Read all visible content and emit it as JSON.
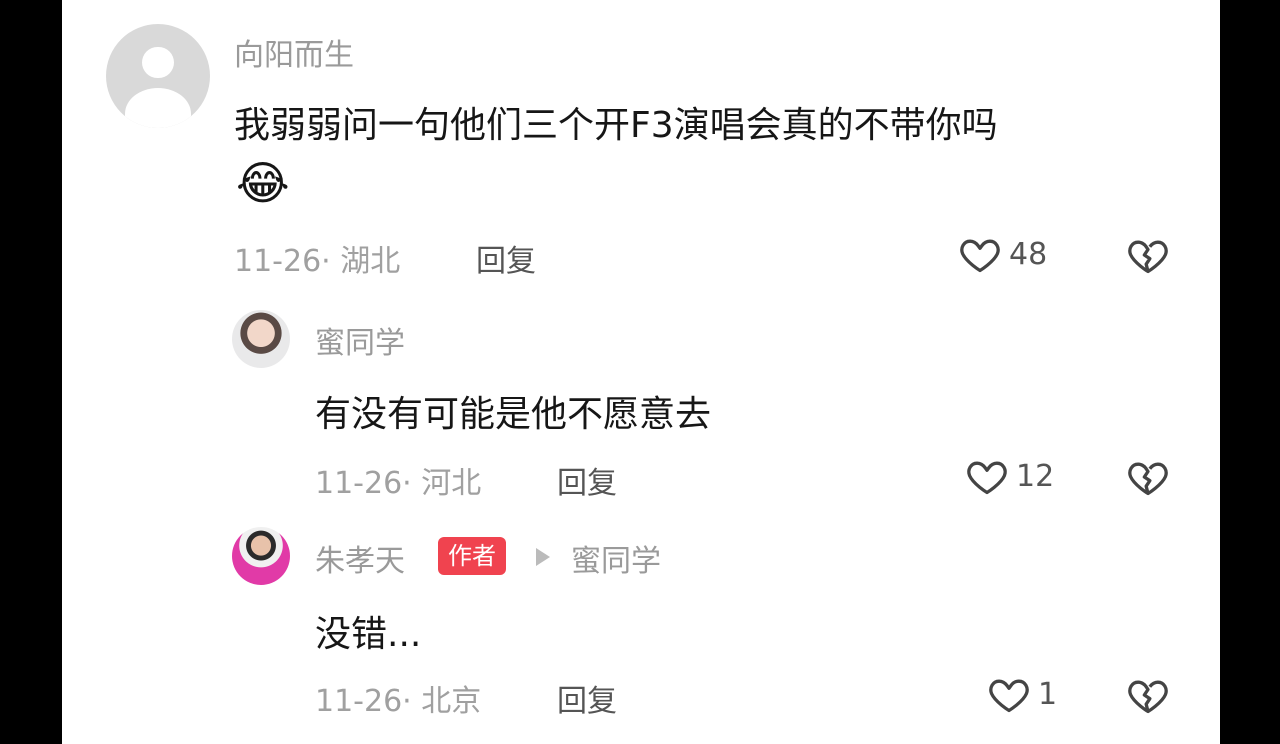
{
  "comments": [
    {
      "username": "向阳而生",
      "text": "我弱弱问一句他们三个开F3演唱会真的不带你吗",
      "emoji": "😂",
      "date": "11-26",
      "location": "湖北",
      "meta": "11-26· 湖北",
      "reply_label": "回复",
      "likes": "48"
    },
    {
      "username": "蜜同学",
      "text": "有没有可能是他不愿意去",
      "date": "11-26",
      "location": "河北",
      "meta": "11-26· 河北",
      "reply_label": "回复",
      "likes": "12"
    },
    {
      "username": "朱孝天",
      "badge": "作者",
      "reply_to": "蜜同学",
      "text": "没错...",
      "date": "11-26",
      "location": "北京",
      "meta": "11-26· 北京",
      "reply_label": "回复",
      "likes": "1"
    }
  ],
  "colors": {
    "badge": "#f0434f",
    "background": "#ffffff",
    "frame": "#000000"
  },
  "icons": {
    "like": "heart-outline-icon",
    "dislike": "broken-heart-icon"
  }
}
